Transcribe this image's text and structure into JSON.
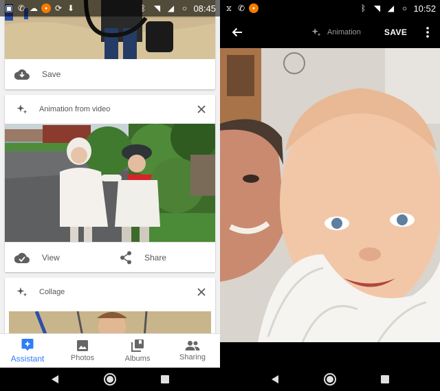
{
  "left": {
    "status": {
      "time": "08:45"
    },
    "cards": [
      {
        "action_label": "Save",
        "icon": "cloud-download-icon"
      },
      {
        "title": "Animation from video",
        "actions": [
          {
            "label": "View",
            "icon": "cloud-done-icon"
          },
          {
            "label": "Share",
            "icon": "share-icon"
          }
        ]
      },
      {
        "title": "Collage"
      }
    ],
    "bottom_nav": [
      {
        "label": "Assistant",
        "icon": "assistant-icon",
        "active": true
      },
      {
        "label": "Photos",
        "icon": "photo-icon",
        "active": false
      },
      {
        "label": "Albums",
        "icon": "albums-icon",
        "active": false
      },
      {
        "label": "Sharing",
        "icon": "people-icon",
        "active": false
      }
    ],
    "accent_color": "#2f7df6"
  },
  "right": {
    "status": {
      "time": "10:52"
    },
    "toolbar": {
      "animation_label": "Animation",
      "save_label": "SAVE"
    }
  },
  "system_nav": [
    "back-icon",
    "home-icon",
    "recents-icon"
  ]
}
